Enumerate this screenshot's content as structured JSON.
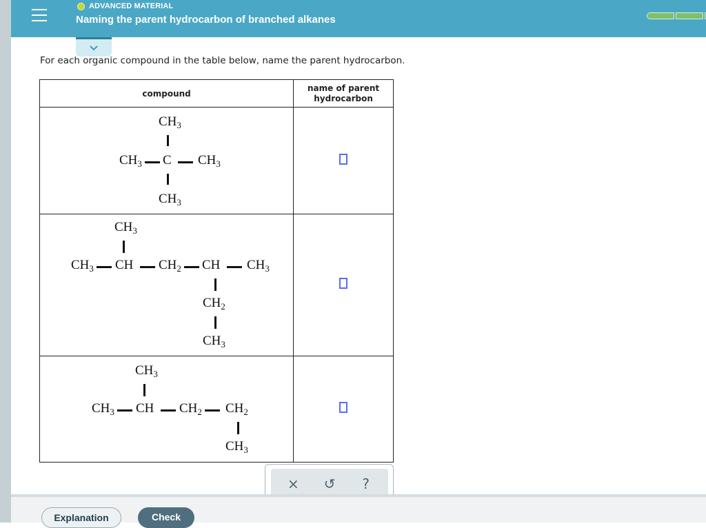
{
  "header": {
    "topic_label": "ADVANCED MATERIAL",
    "title": "Naming the parent hydrocarbon of branched alkanes",
    "topic_dot_color": "#c6d63a",
    "progress_segments_filled": 3
  },
  "instructions": "For each organic compound in the table below, name the parent hydrocarbon.",
  "table": {
    "headers": [
      "compound",
      "name of parent hydrocarbon"
    ],
    "header_compound": "compound",
    "header_name_line1": "name of parent",
    "header_name_line2": "hydrocarbon",
    "rows": [
      {
        "compound_groups": {
          "top": "CH",
          "top_sub": "3",
          "left": "CH",
          "left_sub": "3",
          "center": "C",
          "right": "CH",
          "right_sub": "3",
          "bottom": "CH",
          "bottom_sub": "3"
        },
        "answer": ""
      },
      {
        "compound_groups": {
          "branch_top": "CH",
          "branch_top_sub": "3",
          "c1": "CH",
          "c1_sub": "3",
          "c2": "CH",
          "c3": "CH",
          "c3_sub": "2",
          "c4": "CH",
          "c5": "CH",
          "c5_sub": "3",
          "branch_down1": "CH",
          "branch_down1_sub": "2",
          "branch_down2": "CH",
          "branch_down2_sub": "3"
        },
        "answer": ""
      },
      {
        "compound_groups": {
          "branch_top": "CH",
          "branch_top_sub": "3",
          "c1": "CH",
          "c1_sub": "3",
          "c2": "CH",
          "c3": "CH",
          "c3_sub": "2",
          "c4": "CH",
          "c4_sub": "2",
          "branch_down": "CH",
          "branch_down_sub": "3"
        },
        "answer": ""
      }
    ]
  },
  "tools": {
    "clear": "×",
    "undo": "↺",
    "help": "?"
  },
  "footer": {
    "explanation_label": "Explanation",
    "check_label": "Check"
  }
}
